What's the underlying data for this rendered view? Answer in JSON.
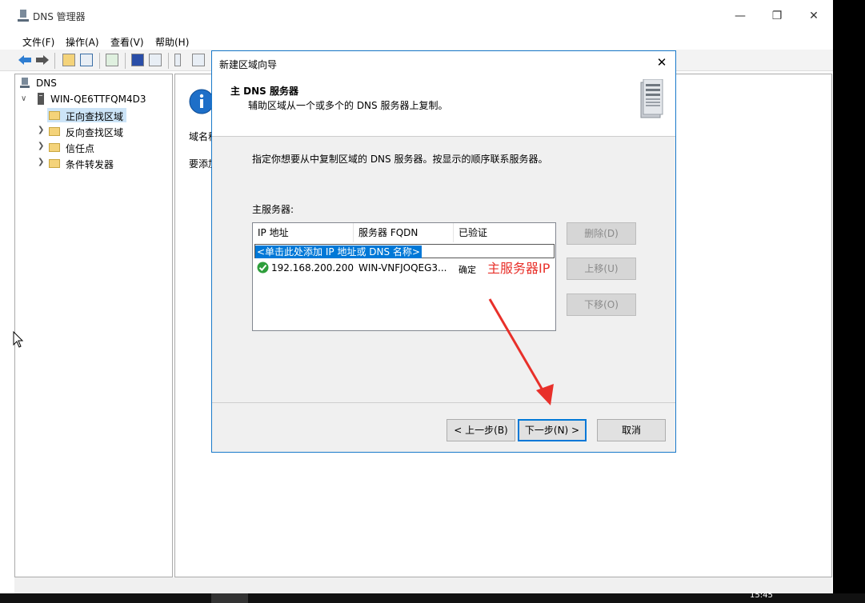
{
  "window": {
    "title": "DNS 管理器",
    "menu": [
      "文件(F)",
      "操作(A)",
      "查看(V)",
      "帮助(H)"
    ]
  },
  "tree": {
    "root": "DNS",
    "server": "WIN-QE6TTFQM4D3",
    "items": [
      "正向查找区域",
      "反向查找区域",
      "信任点",
      "条件转发器"
    ]
  },
  "rightpane": {
    "line1": "域名称",
    "line2": "要添加"
  },
  "dialog": {
    "title": "新建区域向导",
    "heading": "主 DNS 服务器",
    "subheading": "辅助区域从一个或多个的 DNS 服务器上复制。",
    "instruction": "指定你想要从中复制区域的 DNS 服务器。按显示的顺序联系服务器。",
    "list_label": "主服务器:",
    "columns": [
      "IP 地址",
      "服务器 FQDN",
      "已验证"
    ],
    "add_placeholder": "<单击此处添加 IP 地址或 DNS 名称>",
    "rows": [
      {
        "ip": "192.168.200.200",
        "fqdn": "WIN-VNFJOQEG3...",
        "verified": "确定"
      }
    ],
    "side_buttons": {
      "delete": "删除(D)",
      "up": "上移(U)",
      "down": "下移(O)"
    },
    "footer": {
      "back": "< 上一步(B)",
      "next": "下一步(N) >",
      "cancel": "取消"
    }
  },
  "annotation": {
    "text": "主服务器IP",
    "color": "#e8302a"
  },
  "taskbar": {
    "clock": "15:45"
  },
  "colors": {
    "accent": "#0078d7",
    "annotation": "#e8302a",
    "ok": "#2e9e3b"
  }
}
